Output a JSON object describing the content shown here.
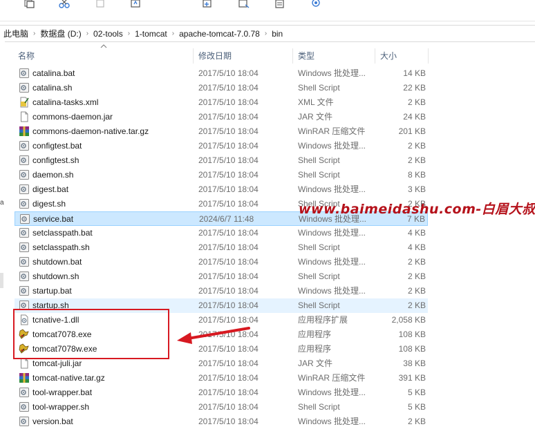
{
  "toolbar": {
    "icons": [
      "copy-icon",
      "cut-icon",
      "paste-icon",
      "move-to-icon",
      "new-item-icon",
      "easy-access-icon",
      "properties-icon",
      "open-icon"
    ]
  },
  "breadcrumb": [
    "此电脑",
    "数据盘 (D:)",
    "02-tools",
    "1-tomcat",
    "apache-tomcat-7.0.78",
    "bin"
  ],
  "columns": {
    "name": "名称",
    "date": "修改日期",
    "type": "类型",
    "size": "大小"
  },
  "files": [
    {
      "name": "catalina.bat",
      "date": "2017/5/10 18:04",
      "type": "Windows 批处理...",
      "size": "14 KB",
      "icon": "bat-file-icon"
    },
    {
      "name": "catalina.sh",
      "date": "2017/5/10 18:04",
      "type": "Shell Script",
      "size": "22 KB",
      "icon": "script-file-icon"
    },
    {
      "name": "catalina-tasks.xml",
      "date": "2017/5/10 18:04",
      "type": "XML 文件",
      "size": "2 KB",
      "icon": "xml-file-icon"
    },
    {
      "name": "commons-daemon.jar",
      "date": "2017/5/10 18:04",
      "type": "JAR 文件",
      "size": "24 KB",
      "icon": "blank-file-icon"
    },
    {
      "name": "commons-daemon-native.tar.gz",
      "date": "2017/5/10 18:04",
      "type": "WinRAR 压缩文件",
      "size": "201 KB",
      "icon": "winrar-file-icon"
    },
    {
      "name": "configtest.bat",
      "date": "2017/5/10 18:04",
      "type": "Windows 批处理...",
      "size": "2 KB",
      "icon": "bat-file-icon"
    },
    {
      "name": "configtest.sh",
      "date": "2017/5/10 18:04",
      "type": "Shell Script",
      "size": "2 KB",
      "icon": "script-file-icon"
    },
    {
      "name": "daemon.sh",
      "date": "2017/5/10 18:04",
      "type": "Shell Script",
      "size": "8 KB",
      "icon": "script-file-icon"
    },
    {
      "name": "digest.bat",
      "date": "2017/5/10 18:04",
      "type": "Windows 批处理...",
      "size": "3 KB",
      "icon": "bat-file-icon"
    },
    {
      "name": "digest.sh",
      "date": "2017/5/10 18:04",
      "type": "Shell Script",
      "size": "2 KB",
      "icon": "script-file-icon"
    },
    {
      "name": "service.bat",
      "date": "2024/6/7 11:48",
      "type": "Windows 批处理...",
      "size": "7 KB",
      "icon": "bat-file-icon",
      "state": "selected"
    },
    {
      "name": "setclasspath.bat",
      "date": "2017/5/10 18:04",
      "type": "Windows 批处理...",
      "size": "4 KB",
      "icon": "bat-file-icon"
    },
    {
      "name": "setclasspath.sh",
      "date": "2017/5/10 18:04",
      "type": "Shell Script",
      "size": "4 KB",
      "icon": "script-file-icon"
    },
    {
      "name": "shutdown.bat",
      "date": "2017/5/10 18:04",
      "type": "Windows 批处理...",
      "size": "2 KB",
      "icon": "bat-file-icon"
    },
    {
      "name": "shutdown.sh",
      "date": "2017/5/10 18:04",
      "type": "Shell Script",
      "size": "2 KB",
      "icon": "script-file-icon"
    },
    {
      "name": "startup.bat",
      "date": "2017/5/10 18:04",
      "type": "Windows 批处理...",
      "size": "2 KB",
      "icon": "bat-file-icon"
    },
    {
      "name": "startup.sh",
      "date": "2017/5/10 18:04",
      "type": "Shell Script",
      "size": "2 KB",
      "icon": "script-file-icon",
      "state": "hover"
    },
    {
      "name": "tcnative-1.dll",
      "date": "2017/5/10 18:04",
      "type": "应用程序扩展",
      "size": "2,058 KB",
      "icon": "dll-file-icon"
    },
    {
      "name": "tomcat7078.exe",
      "date": "2017/5/10 18:04",
      "type": "应用程序",
      "size": "108 KB",
      "icon": "tomcat-exe-icon"
    },
    {
      "name": "tomcat7078w.exe",
      "date": "2017/5/10 18:04",
      "type": "应用程序",
      "size": "108 KB",
      "icon": "tomcat-exe-icon"
    },
    {
      "name": "tomcat-juli.jar",
      "date": "2017/5/10 18:04",
      "type": "JAR 文件",
      "size": "38 KB",
      "icon": "blank-file-icon"
    },
    {
      "name": "tomcat-native.tar.gz",
      "date": "2017/5/10 18:04",
      "type": "WinRAR 压缩文件",
      "size": "391 KB",
      "icon": "winrar-file-icon"
    },
    {
      "name": "tool-wrapper.bat",
      "date": "2017/5/10 18:04",
      "type": "Windows 批处理...",
      "size": "5 KB",
      "icon": "bat-file-icon"
    },
    {
      "name": "tool-wrapper.sh",
      "date": "2017/5/10 18:04",
      "type": "Shell Script",
      "size": "5 KB",
      "icon": "script-file-icon"
    },
    {
      "name": "version.bat",
      "date": "2017/5/10 18:04",
      "type": "Windows 批处理...",
      "size": "2 KB",
      "icon": "bat-file-icon"
    }
  ],
  "watermark": "www.baimeidashu.com-白眉大叔",
  "nav_fragment": "a",
  "colors": {
    "selected_bg": "#cce8ff",
    "hover_bg": "#e5f3ff",
    "annotation_red": "#d71921",
    "watermark_red": "#b5121b",
    "header_text": "#4c607a"
  }
}
